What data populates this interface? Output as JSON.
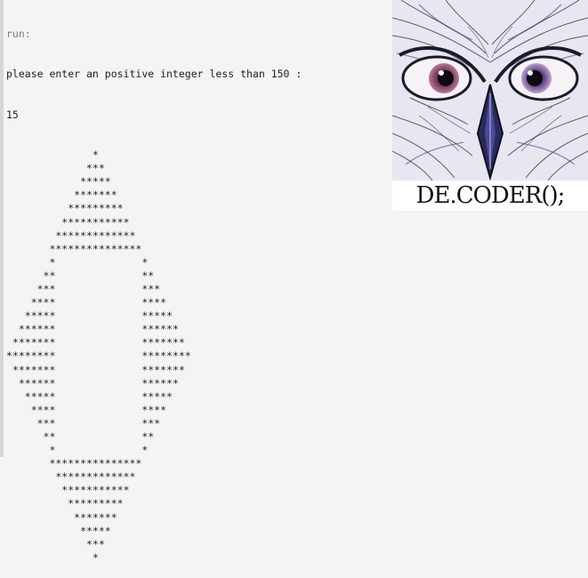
{
  "console": {
    "run_label": "run:",
    "prompt": "please enter an positive integer less than 150 :",
    "input_value": "15",
    "output_lines": [
      "              *",
      "             ***",
      "            *****",
      "           *******",
      "          *********",
      "         ***********",
      "        *************",
      "       ***************",
      "       *              *",
      "      **              **",
      "     ***              ***",
      "    ****              ****",
      "   *****              *****",
      "  ******              ******",
      " *******              *******",
      "********              ********",
      " *******              *******",
      "  ******              ******",
      "   *****              *****",
      "    ****              ****",
      "     ***              ***",
      "      **              **",
      "       *              *",
      "       ***************",
      "        *************",
      "         ***********",
      "          *********",
      "           *******",
      "            *****",
      "             ***",
      "              *"
    ]
  },
  "logo": {
    "brand_text": "DE.CODER();",
    "icon": "owl-sketch-image"
  },
  "colors": {
    "background": "#f4f4f4",
    "text": "#1e1e1e",
    "run_label": "#7d7d7d"
  }
}
